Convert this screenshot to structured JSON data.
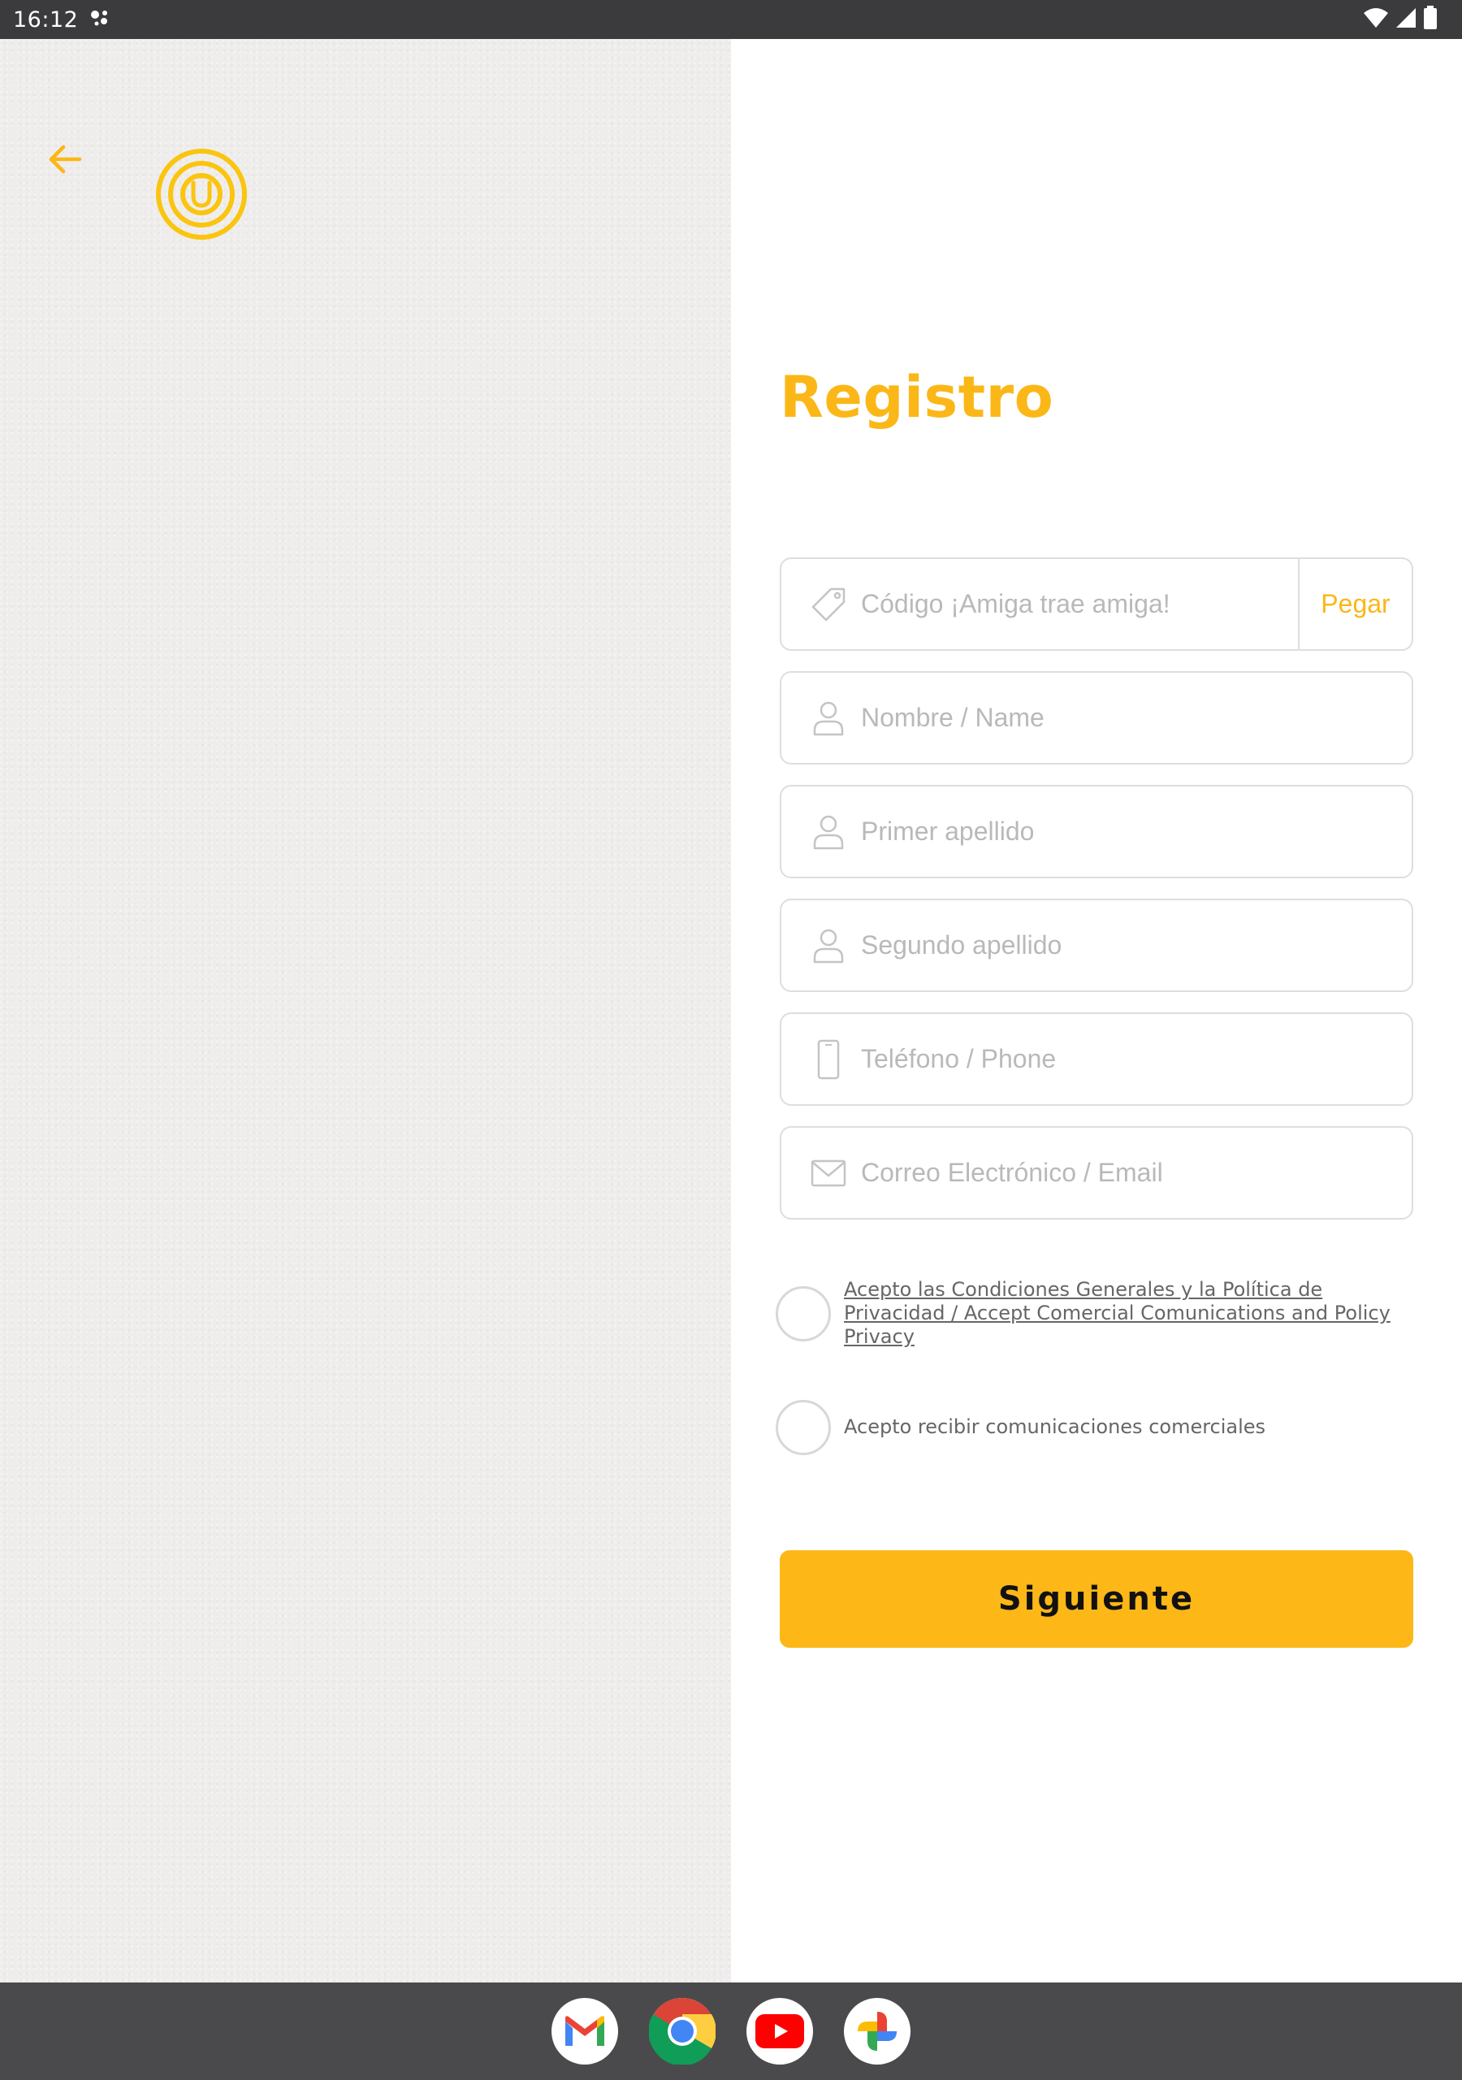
{
  "status_bar": {
    "time": "16:12"
  },
  "form": {
    "title": "Registro",
    "referral_placeholder": "Código ¡Amiga trae amiga!",
    "paste_label": "Pegar",
    "name_placeholder": "Nombre / Name",
    "first_surname_placeholder": "Primer apellido",
    "second_surname_placeholder": "Segundo apellido",
    "phone_placeholder": "Teléfono / Phone",
    "email_placeholder": "Correo Electrónico / Email",
    "terms_label": "Acepto las Condiciones Generales y la Política de Privacidad / Accept Comercial Comunications and Policy Privacy",
    "marketing_label": "Acepto recibir comunicaciones comerciales",
    "terms_checked": false,
    "marketing_checked": false,
    "next_label": "Siguiente"
  },
  "icons": {
    "back": "arrow-left-icon",
    "logo": "brand-logo",
    "referral": "ticket-icon",
    "person": "person-icon",
    "phone": "smartphone-icon",
    "email": "envelope-icon"
  },
  "dock": {
    "apps": [
      "gmail-icon",
      "chrome-icon",
      "youtube-icon",
      "photos-icon"
    ]
  },
  "colors": {
    "accent": "#fbb717",
    "button": "#fdb717",
    "left_panel": "#eeedec",
    "status_bar": "#3b3b3d",
    "dock": "#4a4a4c"
  }
}
